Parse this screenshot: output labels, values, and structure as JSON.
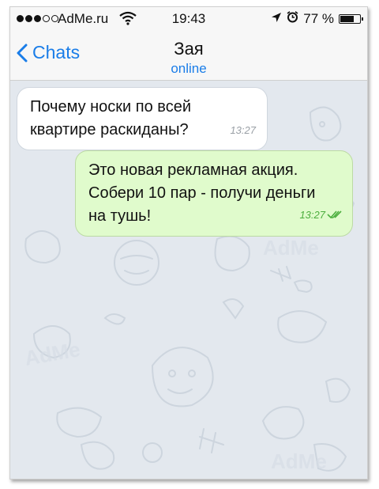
{
  "status_bar": {
    "carrier": "AdMe.ru",
    "time": "19:43",
    "battery": "77 %",
    "battery_level": 0.77
  },
  "nav": {
    "back_label": "Chats",
    "title": "Зая",
    "status": "online"
  },
  "messages": [
    {
      "direction": "incoming",
      "text": "Почему носки по всей\nквартире раскиданы?",
      "time": "13:27"
    },
    {
      "direction": "outgoing",
      "text": "Это новая рекламная акция.\nСобери 10 пар - получи деньги\nна тушь!",
      "time": "13:27",
      "read": true
    }
  ],
  "colors": {
    "accent": "#1a7de8",
    "outgoing_bubble": "#e0fbcc",
    "chat_background": "#e3e8ee"
  }
}
